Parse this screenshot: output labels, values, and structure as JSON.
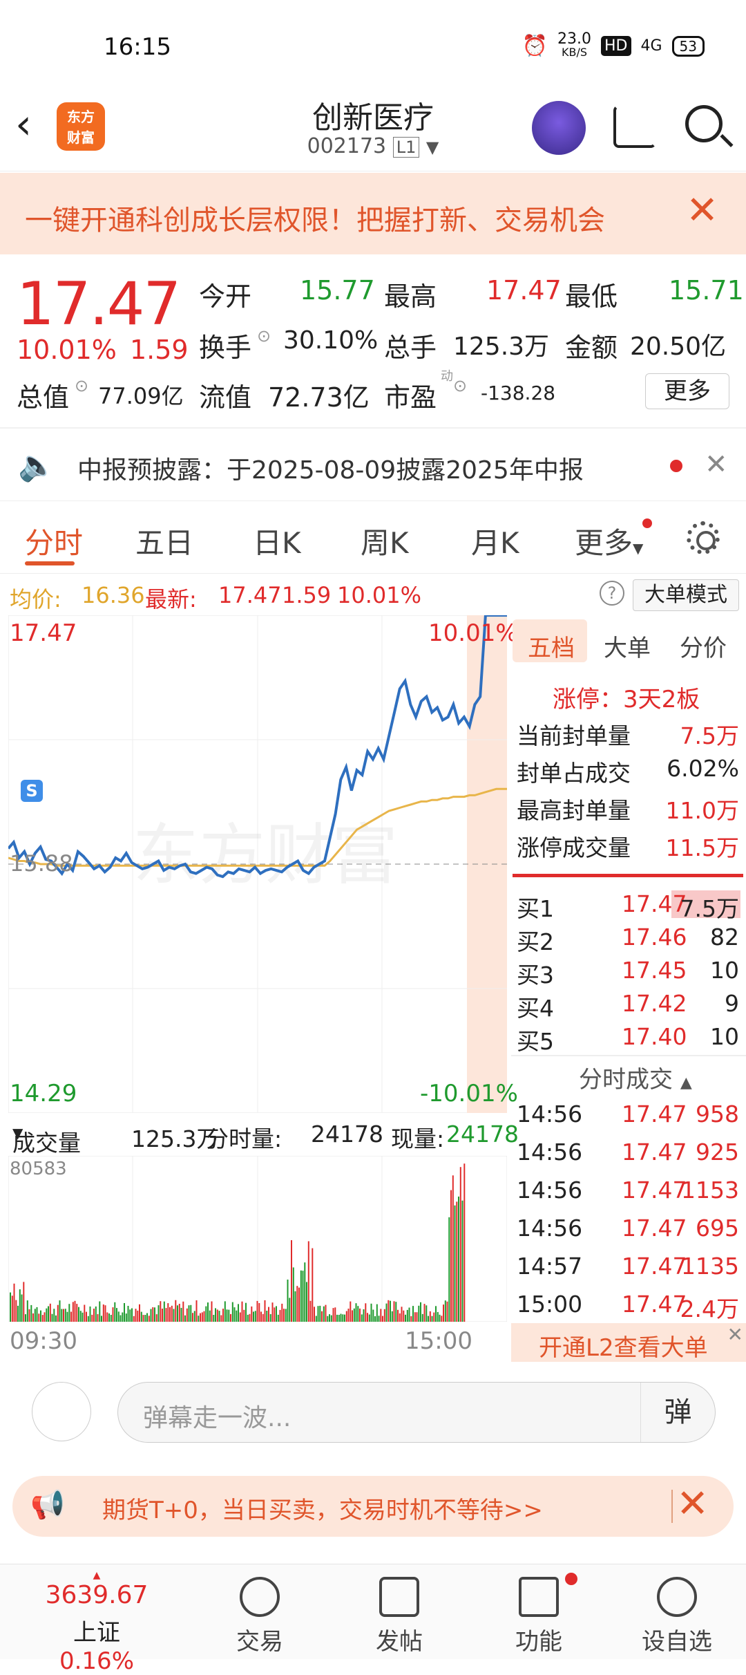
{
  "status_bar": {
    "time": "16:15",
    "speed": "23.0",
    "speed_unit": "KB/S",
    "hd": "HD",
    "signal": "4G",
    "battery": "53"
  },
  "header": {
    "logo_text_1": "东方",
    "logo_text_2": "财富",
    "title": "创新医疗",
    "code": "002173",
    "level": "L1"
  },
  "banner": {
    "text": "一键开通科创成长层权限！把握打新、交易机会"
  },
  "quote": {
    "price": "17.47",
    "change_pct": "10.01%",
    "change": "1.59",
    "open_label": "今开",
    "open": "15.77",
    "high_label": "最高",
    "high": "17.47",
    "low_label": "最低",
    "low": "15.71",
    "turnover_label": "换手",
    "turnover": "30.10%",
    "volume_label": "总手",
    "volume": "125.3万",
    "amount_label": "金额",
    "amount": "20.50亿",
    "mktcap_label": "总值",
    "mktcap": "77.09亿",
    "float_label": "流值",
    "float": "72.73亿",
    "pe_label": "市盈",
    "pe_sup": "动",
    "pe": "-138.28",
    "more": "更多"
  },
  "notice": {
    "text": "中报预披露：于2025-08-09披露2025年中报"
  },
  "tabs": [
    "分时",
    "五日",
    "日K",
    "周K",
    "月K",
    "更多"
  ],
  "avg_row": {
    "avg_label": "均价:",
    "avg": "16.36",
    "latest_label": "最新:",
    "latest": "17.47",
    "chg": "1.59",
    "pct": "10.01%",
    "mode": "大单模式"
  },
  "chart_labels": {
    "top_price": "17.47",
    "top_pct": "10.01%",
    "mid_price": "15.88",
    "bot_price": "14.29",
    "bot_pct": "-10.01%",
    "marker": "S",
    "watermark": "东方财富"
  },
  "chart_data": {
    "type": "line",
    "title": "",
    "ylim": [
      14.29,
      17.47
    ],
    "prev_close": 15.88,
    "x_ticks": [
      "09:30",
      "15:00"
    ],
    "series": [
      {
        "name": "",
        "values": [
          15.98,
          16.02,
          15.92,
          15.96,
          15.88,
          15.95,
          15.99,
          15.91,
          15.9,
          15.86,
          15.82,
          15.88,
          15.84,
          15.96,
          15.93,
          15.89,
          15.85,
          15.87,
          15.83,
          15.86,
          15.92,
          15.9,
          15.95,
          15.89,
          15.87,
          15.85,
          15.86,
          15.88,
          15.9,
          15.84,
          15.86,
          15.85,
          15.87,
          15.88,
          15.83,
          15.82,
          15.84,
          15.86,
          15.85,
          15.81,
          15.8,
          15.83,
          15.82,
          15.85,
          15.84,
          15.83,
          15.86,
          15.82,
          15.84,
          15.85,
          15.84,
          15.83,
          15.86,
          15.88,
          15.9,
          15.84,
          15.82,
          15.86,
          15.88,
          15.9,
          16.05,
          16.2,
          16.42,
          16.5,
          16.35,
          16.48,
          16.45,
          16.6,
          16.55,
          16.62,
          16.55,
          16.7,
          16.85,
          17.0,
          17.05,
          16.9,
          16.82,
          16.92,
          16.95,
          16.85,
          16.88,
          16.8,
          16.82,
          16.9,
          16.78,
          16.82,
          16.76,
          16.9,
          16.95,
          17.47,
          17.47,
          17.47,
          17.47,
          17.47
        ]
      },
      {
        "name": "",
        "values": [
          15.92,
          15.91,
          15.9,
          15.9,
          15.89,
          15.89,
          15.88,
          15.88,
          15.88,
          15.87,
          15.87,
          15.87,
          15.87,
          15.87,
          15.87,
          15.87,
          15.87,
          15.87,
          15.87,
          15.87,
          15.87,
          15.87,
          15.87,
          15.87,
          15.87,
          15.87,
          15.87,
          15.87,
          15.87,
          15.87,
          15.87,
          15.87,
          15.87,
          15.87,
          15.87,
          15.87,
          15.87,
          15.87,
          15.87,
          15.87,
          15.87,
          15.87,
          15.87,
          15.87,
          15.87,
          15.87,
          15.87,
          15.87,
          15.87,
          15.87,
          15.87,
          15.87,
          15.87,
          15.87,
          15.87,
          15.87,
          15.87,
          15.87,
          15.87,
          15.87,
          15.9,
          15.94,
          15.98,
          16.02,
          16.06,
          16.1,
          16.12,
          16.14,
          16.16,
          16.18,
          16.2,
          16.22,
          16.23,
          16.24,
          16.25,
          16.26,
          16.27,
          16.28,
          16.28,
          16.29,
          16.29,
          16.3,
          16.3,
          16.31,
          16.31,
          16.31,
          16.32,
          16.32,
          16.33,
          16.34,
          16.35,
          16.36,
          16.36,
          16.36
        ]
      }
    ]
  },
  "right_panel": {
    "tabs": [
      "五档",
      "大单",
      "分价"
    ],
    "limit_up": "涨停：3天2板",
    "stats": [
      {
        "label": "当前封单量",
        "value": "7.5万"
      },
      {
        "label": "封单占成交",
        "value": "6.02%"
      },
      {
        "label": "最高封单量",
        "value": "11.0万"
      },
      {
        "label": "涨停成交量",
        "value": "11.5万"
      }
    ],
    "bids": [
      {
        "label": "买1",
        "price": "17.47",
        "vol": "7.5万"
      },
      {
        "label": "买2",
        "price": "17.46",
        "vol": "82"
      },
      {
        "label": "买3",
        "price": "17.45",
        "vol": "10"
      },
      {
        "label": "买4",
        "price": "17.42",
        "vol": "9"
      },
      {
        "label": "买5",
        "price": "17.40",
        "vol": "10"
      }
    ],
    "trades_title": "分时成交",
    "trades": [
      {
        "time": "14:56",
        "price": "17.47",
        "vol": "958"
      },
      {
        "time": "14:56",
        "price": "17.47",
        "vol": "925"
      },
      {
        "time": "14:56",
        "price": "17.47",
        "vol": "1153"
      },
      {
        "time": "14:56",
        "price": "17.47",
        "vol": "695"
      },
      {
        "time": "14:57",
        "price": "17.47",
        "vol": "1135"
      },
      {
        "time": "15:00",
        "price": "17.47",
        "vol": "2.4万"
      }
    ],
    "l2": "开通L2查看大单"
  },
  "volume_head": {
    "label": "成交量",
    "total": "125.3万",
    "period_label": "分时量:",
    "period": "24178",
    "now_label": "现量:",
    "now": "24178",
    "max": "80583",
    "t_start": "09:30",
    "t_end": "15:00"
  },
  "comment": {
    "placeholder": "弹幕走一波...",
    "button": "弹"
  },
  "ad": {
    "text": "期货T+0，当日买卖，交易时机不等待>>"
  },
  "bottom_nav": {
    "index_value": "3639.67",
    "index_name": "上证",
    "index_pct": "0.16%",
    "items": [
      "交易",
      "发帖",
      "功能",
      "设自选"
    ]
  }
}
